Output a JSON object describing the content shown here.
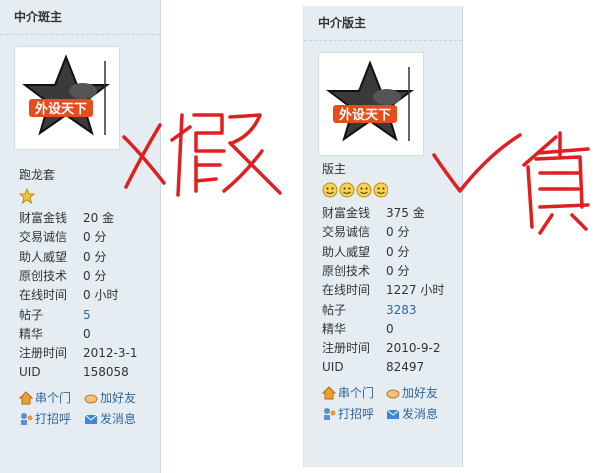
{
  "left": {
    "title": "中介斑主",
    "rank": "跑龙套",
    "stats": [
      {
        "label": "财富金钱",
        "value": "20 金"
      },
      {
        "label": "交易诚信",
        "value": "0 分"
      },
      {
        "label": "助人威望",
        "value": "0 分"
      },
      {
        "label": "原创技术",
        "value": "0 分"
      },
      {
        "label": "在线时间",
        "value": "0 小时"
      },
      {
        "label": "帖子",
        "value": "5"
      },
      {
        "label": "精华",
        "value": "0"
      },
      {
        "label": "注册时间",
        "value": "2012-3-1"
      },
      {
        "label": "UID",
        "value": "158058"
      }
    ],
    "actions": [
      "串个门",
      "加好友",
      "打招呼",
      "发消息"
    ],
    "logo_text": "外设天下"
  },
  "right": {
    "title": "中介版主",
    "rank": "版主",
    "stats": [
      {
        "label": "财富金钱",
        "value": "375 金"
      },
      {
        "label": "交易诚信",
        "value": "0 分"
      },
      {
        "label": "助人威望",
        "value": "0 分"
      },
      {
        "label": "原创技术",
        "value": "0 分"
      },
      {
        "label": "在线时间",
        "value": "1227 小时"
      },
      {
        "label": "帖子",
        "value": "3283"
      },
      {
        "label": "精华",
        "value": "0"
      },
      {
        "label": "注册时间",
        "value": "2010-9-2"
      },
      {
        "label": "UID",
        "value": "82497"
      }
    ],
    "actions": [
      "串个门",
      "加好友",
      "打招呼",
      "发消息"
    ],
    "logo_text": "外设天下"
  },
  "annotations": {
    "fake_text": "X假",
    "real_text": "√真"
  },
  "colors": {
    "panel_bg": "#e5edf2",
    "link": "#336699",
    "ink_red": "#e02020"
  }
}
